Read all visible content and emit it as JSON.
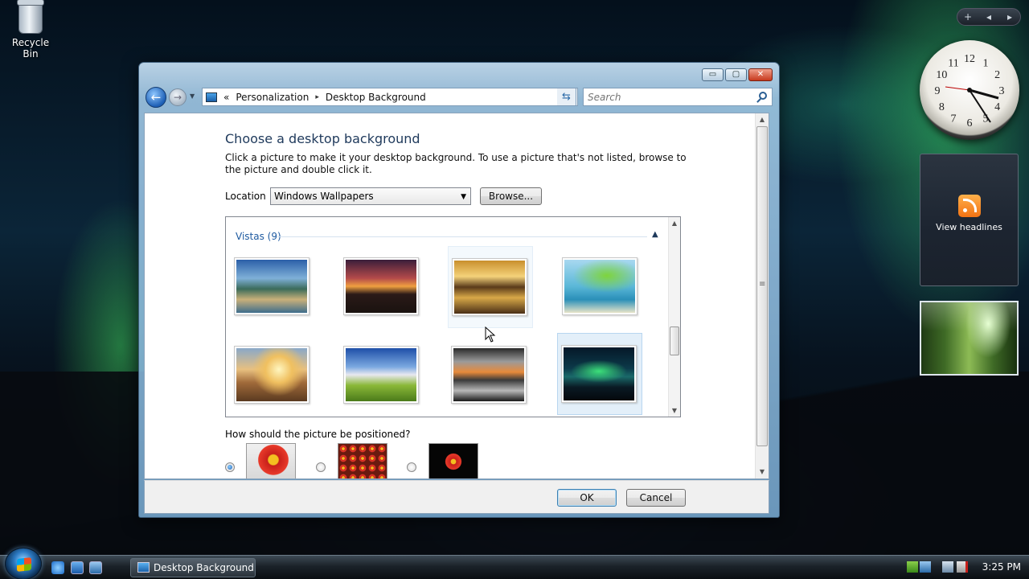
{
  "desktop": {
    "recycle_bin_label": "Recycle Bin"
  },
  "sidebar": {
    "controls": {
      "add": "+",
      "prev": "◂",
      "next": "▸"
    },
    "feed_label": "View headlines",
    "clock_numbers": [
      "12",
      "1",
      "2",
      "3",
      "4",
      "5",
      "6",
      "7",
      "8",
      "9",
      "10",
      "11"
    ]
  },
  "window": {
    "title_buttons": {
      "minimize": "▭",
      "maximize": "▢",
      "close": "✕"
    },
    "breadcrumb": {
      "prefix": "«",
      "root": "Personalization",
      "separator": "▸",
      "current": "Desktop Background"
    },
    "search_placeholder": "Search",
    "heading": "Choose a desktop background",
    "description": "Click a picture to make it your desktop background. To use a picture that's not listed, browse to the picture and double click it.",
    "location_label": "Location",
    "location_value": "Windows Wallpapers",
    "browse_label": "Browse...",
    "group": {
      "label": "Vistas (9)",
      "caret": "▲"
    },
    "position_question": "How should the picture be positioned?",
    "ok_label": "OK",
    "cancel_label": "Cancel"
  },
  "taskbar": {
    "task_label": "Desktop Background",
    "time": "3:25 PM"
  },
  "colors": {
    "accent": "#1e395b",
    "link": "#1e5aa0"
  }
}
